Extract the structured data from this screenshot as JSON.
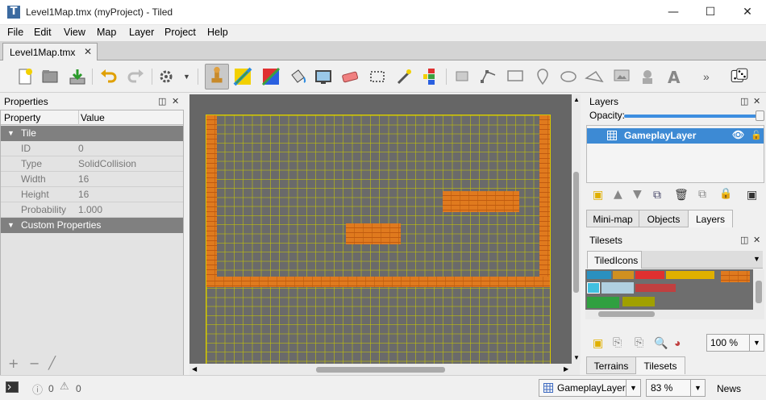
{
  "window": {
    "title": "Level1Map.tmx (myProject) - Tiled",
    "minimize": "—",
    "maximize": "☐",
    "close": "✕"
  },
  "menu": [
    "File",
    "Edit",
    "View",
    "Map",
    "Layer",
    "Project",
    "Help"
  ],
  "doc_tab": {
    "label": "Level1Map.tmx",
    "close": "✕"
  },
  "properties": {
    "title": "Properties",
    "columns": [
      "Property",
      "Value"
    ],
    "group_tile": "Tile",
    "rows": [
      {
        "key": "ID",
        "value": "0"
      },
      {
        "key": "Type",
        "value": "SolidCollision"
      },
      {
        "key": "Width",
        "value": "16"
      },
      {
        "key": "Height",
        "value": "16"
      },
      {
        "key": "Probability",
        "value": "1.000"
      }
    ],
    "group_custom": "Custom Properties",
    "footer_icons": [
      "add-icon",
      "remove-icon",
      "edit-icon"
    ]
  },
  "layers_panel": {
    "title": "Layers",
    "opacity_label": "Opacity:",
    "opacity_value": 1.0,
    "layers": [
      {
        "name": "GameplayLayer",
        "visible": true
      }
    ],
    "tabs": [
      "Mini-map",
      "Objects",
      "Layers"
    ],
    "active_tab": "Layers"
  },
  "tilesets_panel": {
    "title": "Tilesets",
    "tab": "TiledIcons",
    "zoom": "100 %",
    "tabs": [
      "Terrains",
      "Tilesets"
    ],
    "active_tab": "Tilesets"
  },
  "status": {
    "errors": "0",
    "warnings": "0",
    "layer_combo": "GameplayLayer",
    "zoom": "83 %",
    "news": "News"
  },
  "colors": {
    "accent": "#3d8ad4",
    "brick": "#e07a1e",
    "grid": "#c8c800",
    "canvas_bg": "#666666"
  }
}
